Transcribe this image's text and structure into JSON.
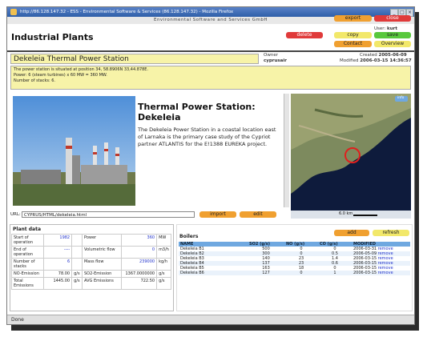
{
  "window": {
    "title": "http://86.128.147.32 - ESS - Environmental Software & Services (86.128.147.32) - Mozilla Firefox",
    "header_banner": "Environmental Software and Services GmbH"
  },
  "app": {
    "title": "Industrial Plants",
    "buttons": {
      "export": "export",
      "close": "close",
      "delete": "delete",
      "copy": "copy",
      "save": "save",
      "contact": "Contact",
      "overview": "Overview"
    },
    "user_label": "User:",
    "user_name": "kurt"
  },
  "plant": {
    "name": "Dekeleia Thermal Power Station",
    "owner_label": "Owner",
    "owner": "cyprusair",
    "created_label": "Created",
    "created": "2005-06-09",
    "modified_label": "Modified",
    "modified": "2006-03-15 14:36:57",
    "info_lines": [
      "The power station is situated at position 34, 58.8906N  33,44.878E.",
      "Power: 6 (steam turbines) x 60 MW = 360 MW.",
      "Number of stacks: 6."
    ]
  },
  "content": {
    "heading": "Thermal Power Station: Dekeleia",
    "paragraph": "The Dekeleia Power Station in a coastal location east of Larnaka is the primary case study of the Cypriot partner ATLANTIS for the E!1388 EUREKA project."
  },
  "url_row": {
    "label": "URL:",
    "value": "CYPRUS/HTML/dekeleia.html",
    "import": "import",
    "edit": "edit"
  },
  "map": {
    "scale": "6.0 km",
    "badge": "info"
  },
  "plant_data": {
    "title": "Plant data",
    "rows": [
      {
        "l1": "Start of operation",
        "v1": "1982",
        "u1": "",
        "l2": "Power",
        "v2": "360",
        "u2": "MW"
      },
      {
        "l1": "End of operation",
        "v1": "----",
        "u1": "",
        "l2": "Volumetric flow",
        "v2": "0",
        "u2": "m3/h"
      },
      {
        "l1": "Number of stacks",
        "v1": "6",
        "u1": "",
        "l2": "Mass flow",
        "v2": "239000",
        "u2": "kg/h"
      },
      {
        "l1": "NO-Emission",
        "v1": "78.00",
        "u1": "g/s",
        "l2": "SO2-Emission",
        "v2": "1367.0000000",
        "u2": "g/s"
      },
      {
        "l1": "Total Emissions",
        "v1": "1445.00",
        "u1": "g/s",
        "l2": "AVG Emissions",
        "v2": "722.50",
        "u2": "g/s"
      }
    ]
  },
  "boilers": {
    "title": "Boilers",
    "add": "add",
    "refresh": "refresh",
    "columns": [
      "NAME",
      "SO2 (g/s)",
      "NO (g/s)",
      "CO (g/s)",
      "MODIFIED"
    ],
    "remove_label": "remove",
    "rows": [
      {
        "name": "Dekeleia B1",
        "so2": "500",
        "no": "0",
        "co": "0",
        "modified": "2006-03-31"
      },
      {
        "name": "Dekeleia B2",
        "so2": "300",
        "no": "0",
        "co": "0.5",
        "modified": "2006-05-09"
      },
      {
        "name": "Dekeleia B3",
        "so2": "140",
        "no": "23",
        "co": "1.4",
        "modified": "2006-03-15"
      },
      {
        "name": "Dekeleia B4",
        "so2": "137",
        "no": "23",
        "co": "0.6",
        "modified": "2006-03-15"
      },
      {
        "name": "Dekeleia B5",
        "so2": "163",
        "no": "18",
        "co": "0",
        "modified": "2006-03-15"
      },
      {
        "name": "Dekeleia B6",
        "so2": "127",
        "no": "0",
        "co": "1",
        "modified": "2006-03-15"
      }
    ]
  },
  "statusbar": {
    "text": "Done"
  }
}
